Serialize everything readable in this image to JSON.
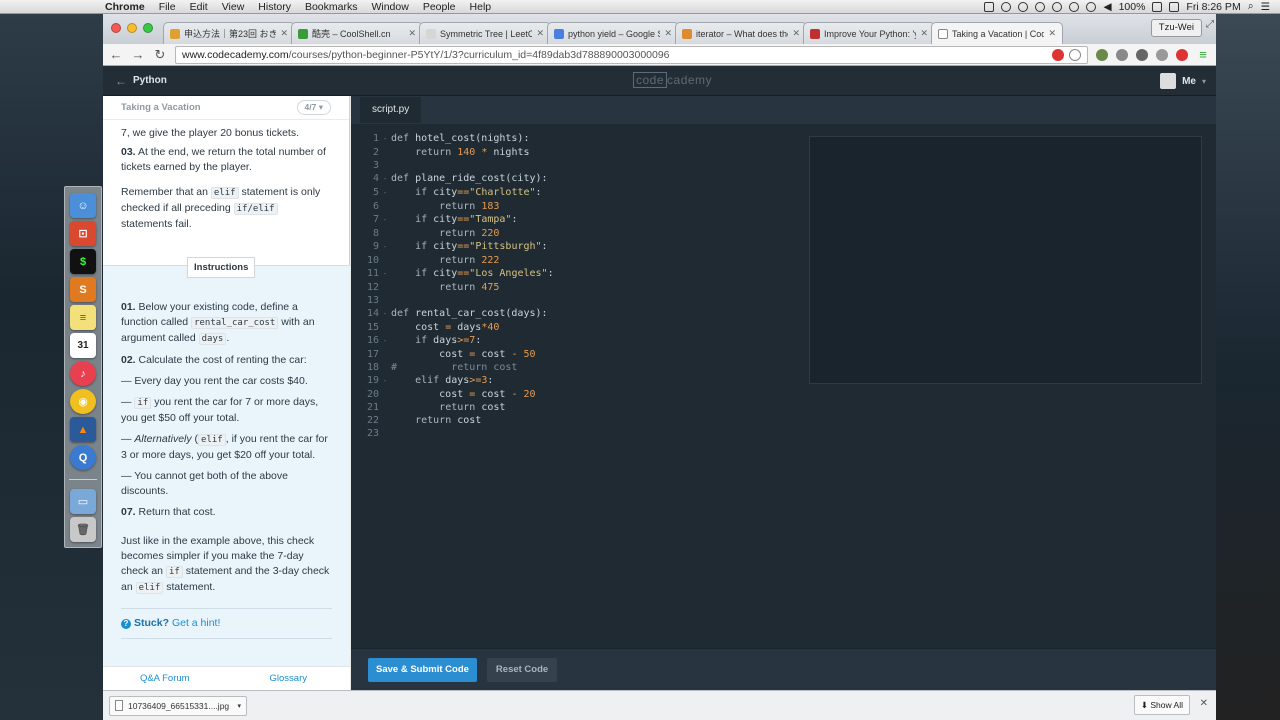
{
  "menubar": {
    "app": "Chrome",
    "items": [
      "File",
      "Edit",
      "View",
      "History",
      "Bookmarks",
      "Window",
      "People",
      "Help"
    ],
    "battery": "100%",
    "clock": "Fri 8:26 PM"
  },
  "browser": {
    "tabs": [
      {
        "label": "申込方法｜第23回 おきなわ",
        "color": "#e0a030"
      },
      {
        "label": "酷壳 – CoolShell.cn",
        "color": "#3a9b3a"
      },
      {
        "label": "Symmetric Tree | LeetCode",
        "color": "#d6d6d6"
      },
      {
        "label": "python yield – Google Sea",
        "color": "#4a7fe0"
      },
      {
        "label": "iterator – What does the yi",
        "color": "#e08a30"
      },
      {
        "label": "Improve Your Python: 'yield'",
        "color": "#c03030"
      },
      {
        "label": "Taking a Vacation | Codeca",
        "color": "#ffffff"
      }
    ],
    "profile": "Tzu-Wei",
    "url_host": "www.codecademy.com",
    "url_path": "/courses/python-beginner-P5YtY/1/3?curriculum_id=4f89dab3d788890003000096"
  },
  "header": {
    "course": "Python",
    "logo_left": "code",
    "logo_right": "cademy",
    "user": "Me"
  },
  "lesson": {
    "title": "Taking a Vacation",
    "progress": "4/7",
    "line_top": "7, we give the player 20 bonus tickets.",
    "p03_num": "03.",
    "p03_text": "At the end, we return the total number of tickets earned by the player.",
    "remember_1": "Remember that an",
    "remember_code1": "elif",
    "remember_2": "statement is only checked if all preceding",
    "remember_code2": "if/elif",
    "remember_3": "statements fail."
  },
  "instructions": {
    "tab": "Instructions",
    "s1_num": "01.",
    "s1_a": "Below your existing code, define a function called",
    "s1_code": "rental_car_cost",
    "s1_b": "with an argument called",
    "s1_code2": "days",
    "s1_c": ".",
    "s2_num": "02.",
    "s2_text": "Calculate the cost of renting the car:",
    "b1": "— Every day you rent the car costs $40.",
    "b2_a": "—",
    "b2_code": "if",
    "b2_b": "you rent the car for 7 or more days, you get $50 off your total.",
    "b3_a": "—",
    "b3_em": "Alternatively",
    "b3_code": "elif",
    "b3_b": ", if you rent the car for 3 or more days, you get $20 off your total.",
    "b4": "— You cannot get both of the above discounts.",
    "s7_num": "07.",
    "s7_text": "Return that cost.",
    "just_a": "Just like in the example above, this check becomes simpler if you make the 7-day check an",
    "just_code1": "if",
    "just_b": "statement and the 3-day check an",
    "just_code2": "elif",
    "just_c": "statement.",
    "stuck": "Stuck?",
    "hint": "Get a hint!",
    "qa": "Q&A Forum",
    "glossary": "Glossary"
  },
  "editor": {
    "filename": "script.py",
    "submit": "Save & Submit Code",
    "reset": "Reset Code"
  },
  "downloads": {
    "file": "10736409_66515331....jpg",
    "show_all": "Show All"
  }
}
